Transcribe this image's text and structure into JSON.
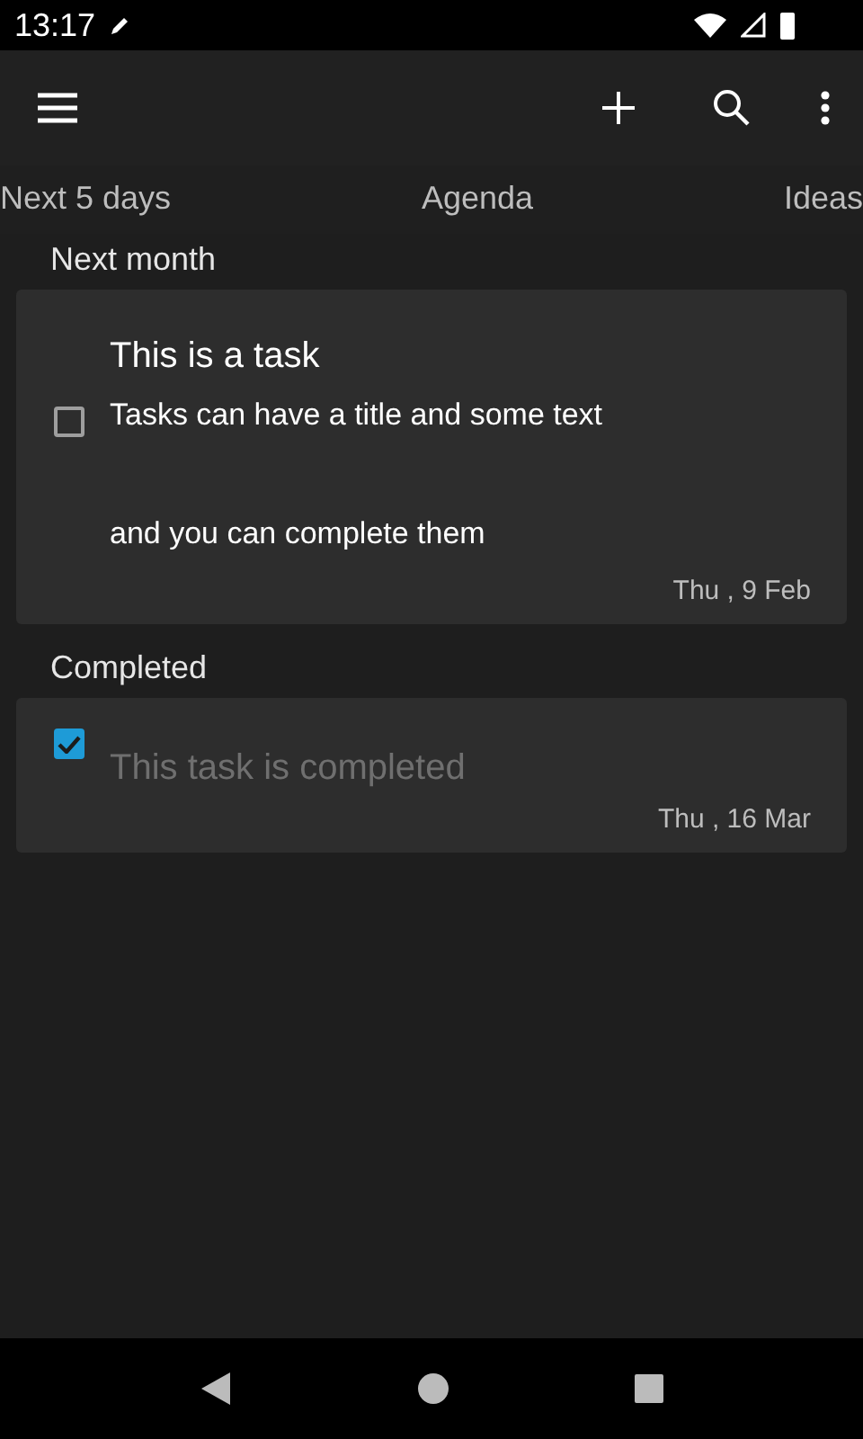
{
  "status_bar": {
    "time": "13:17"
  },
  "tabs": [
    {
      "label": "Next 5 days",
      "selected": false
    },
    {
      "label": "Agenda",
      "selected": false
    },
    {
      "label": "Ideas",
      "selected": false
    }
  ],
  "sections": [
    {
      "heading": "Next month",
      "tasks": [
        {
          "title": "This is a task",
          "body": [
            "Tasks can have a title and some text",
            "and you can complete them"
          ],
          "date": "Thu , 9 Feb",
          "checked": false
        }
      ]
    },
    {
      "heading": "Completed",
      "tasks": [
        {
          "title": "This task is completed",
          "date": "Thu , 16 Mar",
          "checked": true
        }
      ]
    }
  ]
}
